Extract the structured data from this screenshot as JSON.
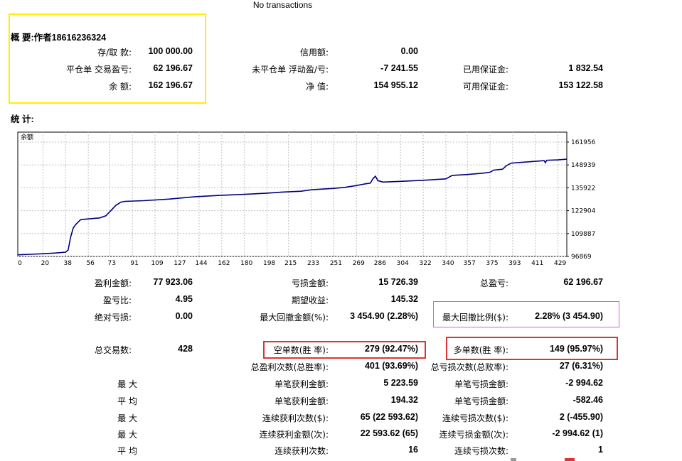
{
  "header": {
    "note": "No transactions"
  },
  "summary": {
    "title": "概 要:作者18616236324",
    "rows": [
      [
        {
          "label": "存/取 款:",
          "value": "100 000.00"
        },
        {
          "label": "信用额:",
          "value": "0.00"
        },
        {
          "label": "",
          "value": ""
        }
      ],
      [
        {
          "label": "平仓单 交易盈亏:",
          "value": "62 196.67"
        },
        {
          "label": "未平仓单 浮动盈/亏:",
          "value": "-7 241.55"
        },
        {
          "label": "已用保证金:",
          "value": "1 832.54"
        }
      ],
      [
        {
          "label": "余 额:",
          "value": "162 196.67"
        },
        {
          "label": "净 值:",
          "value": "154 955.12"
        },
        {
          "label": "可用保证金:",
          "value": "153 122.58"
        }
      ]
    ]
  },
  "stats_title": "统 计:",
  "chart_data": {
    "type": "line",
    "title": "余额",
    "x_ticks": [
      "0",
      "20",
      "38",
      "56",
      "73",
      "91",
      "109",
      "127",
      "144",
      "162",
      "180",
      "198",
      "215",
      "233",
      "251",
      "269",
      "286",
      "304",
      "322",
      "340",
      "357",
      "375",
      "393",
      "411",
      "429"
    ],
    "y_ticks": [
      "161956",
      "148939",
      "135922",
      "122904",
      "109887",
      "96869"
    ],
    "xlim": [
      0,
      436
    ],
    "ylim": [
      96869,
      161956
    ],
    "grid": true,
    "series": [
      {
        "values": [
          [
            0,
            97800
          ],
          [
            10,
            98100
          ],
          [
            20,
            98400
          ],
          [
            30,
            98800
          ],
          [
            38,
            99300
          ],
          [
            40,
            100500
          ],
          [
            42,
            108000
          ],
          [
            44,
            113000
          ],
          [
            46,
            115000
          ],
          [
            50,
            117800
          ],
          [
            56,
            118200
          ],
          [
            65,
            118800
          ],
          [
            70,
            120000
          ],
          [
            72,
            121500
          ],
          [
            74,
            123000
          ],
          [
            78,
            126000
          ],
          [
            82,
            127800
          ],
          [
            85,
            128200
          ],
          [
            100,
            128600
          ],
          [
            120,
            129500
          ],
          [
            140,
            130800
          ],
          [
            160,
            131600
          ],
          [
            180,
            132200
          ],
          [
            198,
            132900
          ],
          [
            210,
            133500
          ],
          [
            225,
            134000
          ],
          [
            233,
            134800
          ],
          [
            251,
            135600
          ],
          [
            260,
            136200
          ],
          [
            269,
            137200
          ],
          [
            276,
            138200
          ],
          [
            280,
            138600
          ],
          [
            282,
            141000
          ],
          [
            284,
            142500
          ],
          [
            286,
            140000
          ],
          [
            290,
            139200
          ],
          [
            304,
            139600
          ],
          [
            322,
            140200
          ],
          [
            340,
            141000
          ],
          [
            345,
            143000
          ],
          [
            357,
            143500
          ],
          [
            370,
            144300
          ],
          [
            375,
            144800
          ],
          [
            378,
            146000
          ],
          [
            385,
            146500
          ],
          [
            388,
            148500
          ],
          [
            392,
            150000
          ],
          [
            400,
            150400
          ],
          [
            411,
            151000
          ],
          [
            418,
            151400
          ],
          [
            419,
            150200
          ],
          [
            420,
            151600
          ],
          [
            429,
            151800
          ],
          [
            436,
            152200
          ]
        ],
        "color": "#00007f"
      }
    ]
  },
  "stats": {
    "r1": [
      {
        "label": "盈利金额:",
        "value": "77 923.06"
      },
      {
        "label": "亏损金额:",
        "value": "15 726.39"
      },
      {
        "label": "总盈亏:",
        "value": "62 196.67"
      }
    ],
    "r2": [
      {
        "label": "盈亏比:",
        "value": "4.95"
      },
      {
        "label": "期望收益:",
        "value": "145.32"
      }
    ],
    "r3": [
      {
        "label": "绝对亏损:",
        "value": "0.00"
      },
      {
        "label": "最大回撤金额(%):",
        "value": "3 454.90 (2.28%)"
      },
      {
        "label": "最大回撤比例($):",
        "value": "2.28% (3 454.90)"
      }
    ],
    "r4": [
      {
        "label": "总交易数:",
        "value": "428"
      },
      {
        "label": "空单数(胜 率):",
        "value": "279 (92.47%)"
      },
      {
        "label": "多单数(胜 率):",
        "value": "149 (95.97%)"
      }
    ],
    "r5": [
      {
        "label": "总盈利次数(总胜率):",
        "value": "401 (93.69%)"
      },
      {
        "label": "总亏损次数(总败率):",
        "value": "27 (6.31%)"
      }
    ],
    "r6": [
      {
        "label": "最 大",
        "value": ""
      },
      {
        "label": "单笔获利金额:",
        "value": "5 223.59"
      },
      {
        "label": "单笔亏损金额:",
        "value": "-2 994.62"
      }
    ],
    "r7": [
      {
        "label": "平 均",
        "value": ""
      },
      {
        "label": "单笔获利金额:",
        "value": "194.32"
      },
      {
        "label": "单笔亏损金额:",
        "value": "-582.46"
      }
    ],
    "r8": [
      {
        "label": "最 大",
        "value": ""
      },
      {
        "label": "连续获利次数($):",
        "value": "65 (22 593.62)"
      },
      {
        "label": "连续亏损次数($):",
        "value": "2 (-455.90)"
      }
    ],
    "r9": [
      {
        "label": "最 大",
        "value": ""
      },
      {
        "label": "连续获利金额(次):",
        "value": "22 593.62 (65)"
      },
      {
        "label": "连续亏损金额(次):",
        "value": "-2 994.62 (1)"
      }
    ],
    "r10": [
      {
        "label": "平 均",
        "value": ""
      },
      {
        "label": "连续获利次数:",
        "value": "16"
      },
      {
        "label": "连续亏损次数:",
        "value": "1"
      }
    ]
  }
}
